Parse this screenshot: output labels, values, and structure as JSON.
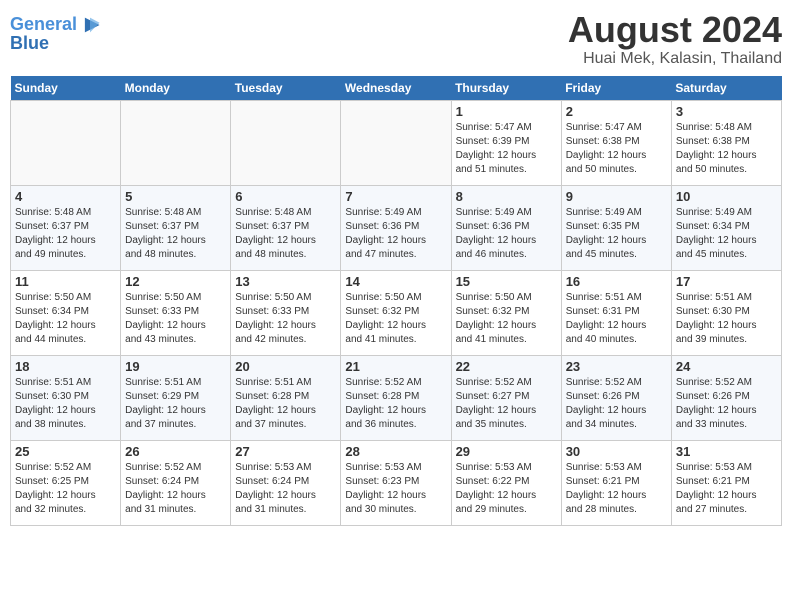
{
  "header": {
    "logo_line1": "General",
    "logo_line2": "Blue",
    "month_title": "August 2024",
    "location": "Huai Mek, Kalasin, Thailand"
  },
  "days_of_week": [
    "Sunday",
    "Monday",
    "Tuesday",
    "Wednesday",
    "Thursday",
    "Friday",
    "Saturday"
  ],
  "weeks": [
    [
      {
        "day": "",
        "info": ""
      },
      {
        "day": "",
        "info": ""
      },
      {
        "day": "",
        "info": ""
      },
      {
        "day": "",
        "info": ""
      },
      {
        "day": "1",
        "info": "Sunrise: 5:47 AM\nSunset: 6:39 PM\nDaylight: 12 hours\nand 51 minutes."
      },
      {
        "day": "2",
        "info": "Sunrise: 5:47 AM\nSunset: 6:38 PM\nDaylight: 12 hours\nand 50 minutes."
      },
      {
        "day": "3",
        "info": "Sunrise: 5:48 AM\nSunset: 6:38 PM\nDaylight: 12 hours\nand 50 minutes."
      }
    ],
    [
      {
        "day": "4",
        "info": "Sunrise: 5:48 AM\nSunset: 6:37 PM\nDaylight: 12 hours\nand 49 minutes."
      },
      {
        "day": "5",
        "info": "Sunrise: 5:48 AM\nSunset: 6:37 PM\nDaylight: 12 hours\nand 48 minutes."
      },
      {
        "day": "6",
        "info": "Sunrise: 5:48 AM\nSunset: 6:37 PM\nDaylight: 12 hours\nand 48 minutes."
      },
      {
        "day": "7",
        "info": "Sunrise: 5:49 AM\nSunset: 6:36 PM\nDaylight: 12 hours\nand 47 minutes."
      },
      {
        "day": "8",
        "info": "Sunrise: 5:49 AM\nSunset: 6:36 PM\nDaylight: 12 hours\nand 46 minutes."
      },
      {
        "day": "9",
        "info": "Sunrise: 5:49 AM\nSunset: 6:35 PM\nDaylight: 12 hours\nand 45 minutes."
      },
      {
        "day": "10",
        "info": "Sunrise: 5:49 AM\nSunset: 6:34 PM\nDaylight: 12 hours\nand 45 minutes."
      }
    ],
    [
      {
        "day": "11",
        "info": "Sunrise: 5:50 AM\nSunset: 6:34 PM\nDaylight: 12 hours\nand 44 minutes."
      },
      {
        "day": "12",
        "info": "Sunrise: 5:50 AM\nSunset: 6:33 PM\nDaylight: 12 hours\nand 43 minutes."
      },
      {
        "day": "13",
        "info": "Sunrise: 5:50 AM\nSunset: 6:33 PM\nDaylight: 12 hours\nand 42 minutes."
      },
      {
        "day": "14",
        "info": "Sunrise: 5:50 AM\nSunset: 6:32 PM\nDaylight: 12 hours\nand 41 minutes."
      },
      {
        "day": "15",
        "info": "Sunrise: 5:50 AM\nSunset: 6:32 PM\nDaylight: 12 hours\nand 41 minutes."
      },
      {
        "day": "16",
        "info": "Sunrise: 5:51 AM\nSunset: 6:31 PM\nDaylight: 12 hours\nand 40 minutes."
      },
      {
        "day": "17",
        "info": "Sunrise: 5:51 AM\nSunset: 6:30 PM\nDaylight: 12 hours\nand 39 minutes."
      }
    ],
    [
      {
        "day": "18",
        "info": "Sunrise: 5:51 AM\nSunset: 6:30 PM\nDaylight: 12 hours\nand 38 minutes."
      },
      {
        "day": "19",
        "info": "Sunrise: 5:51 AM\nSunset: 6:29 PM\nDaylight: 12 hours\nand 37 minutes."
      },
      {
        "day": "20",
        "info": "Sunrise: 5:51 AM\nSunset: 6:28 PM\nDaylight: 12 hours\nand 37 minutes."
      },
      {
        "day": "21",
        "info": "Sunrise: 5:52 AM\nSunset: 6:28 PM\nDaylight: 12 hours\nand 36 minutes."
      },
      {
        "day": "22",
        "info": "Sunrise: 5:52 AM\nSunset: 6:27 PM\nDaylight: 12 hours\nand 35 minutes."
      },
      {
        "day": "23",
        "info": "Sunrise: 5:52 AM\nSunset: 6:26 PM\nDaylight: 12 hours\nand 34 minutes."
      },
      {
        "day": "24",
        "info": "Sunrise: 5:52 AM\nSunset: 6:26 PM\nDaylight: 12 hours\nand 33 minutes."
      }
    ],
    [
      {
        "day": "25",
        "info": "Sunrise: 5:52 AM\nSunset: 6:25 PM\nDaylight: 12 hours\nand 32 minutes."
      },
      {
        "day": "26",
        "info": "Sunrise: 5:52 AM\nSunset: 6:24 PM\nDaylight: 12 hours\nand 31 minutes."
      },
      {
        "day": "27",
        "info": "Sunrise: 5:53 AM\nSunset: 6:24 PM\nDaylight: 12 hours\nand 31 minutes."
      },
      {
        "day": "28",
        "info": "Sunrise: 5:53 AM\nSunset: 6:23 PM\nDaylight: 12 hours\nand 30 minutes."
      },
      {
        "day": "29",
        "info": "Sunrise: 5:53 AM\nSunset: 6:22 PM\nDaylight: 12 hours\nand 29 minutes."
      },
      {
        "day": "30",
        "info": "Sunrise: 5:53 AM\nSunset: 6:21 PM\nDaylight: 12 hours\nand 28 minutes."
      },
      {
        "day": "31",
        "info": "Sunrise: 5:53 AM\nSunset: 6:21 PM\nDaylight: 12 hours\nand 27 minutes."
      }
    ]
  ]
}
